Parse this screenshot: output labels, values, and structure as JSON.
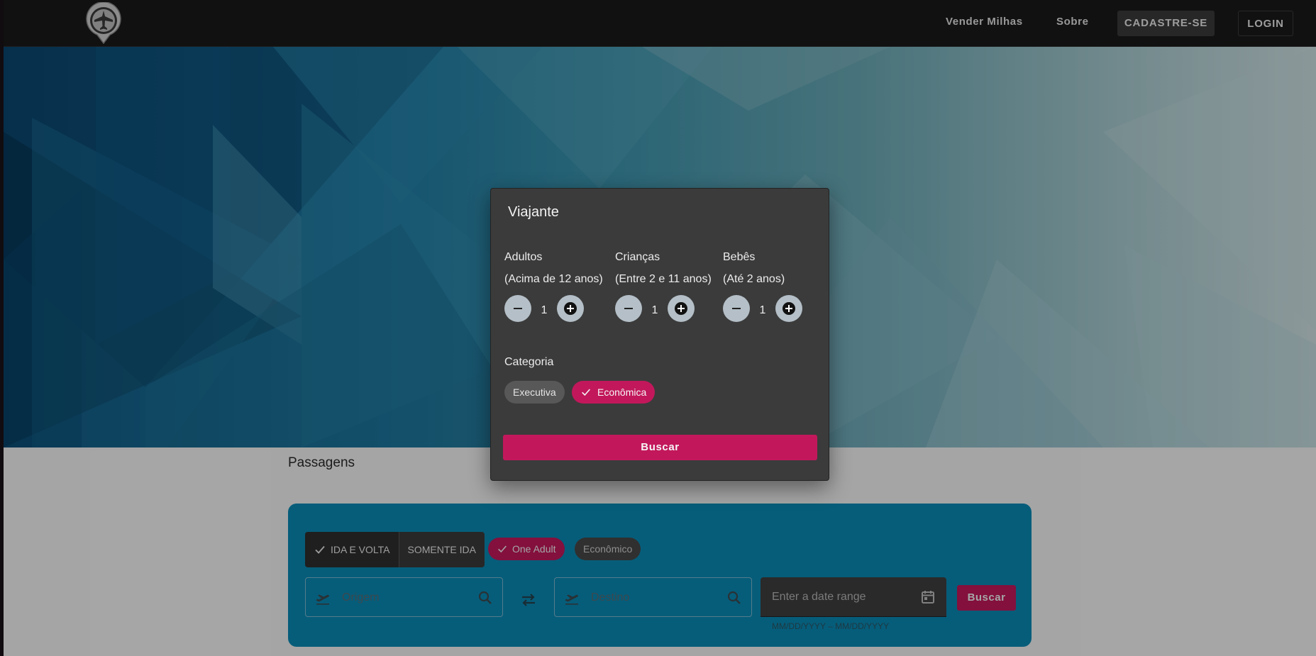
{
  "header": {
    "logo_icon": "airplane-pin-icon",
    "nav": {
      "vender_milhas": "Vender Milhas",
      "sobre": "Sobre",
      "cadastre": "CADASTRE-SE",
      "login": "LOGIN"
    }
  },
  "page": {
    "section_title": "Passagens"
  },
  "search": {
    "trip_types": [
      {
        "label": "IDA E VOLTA",
        "selected": true
      },
      {
        "label": "SOMENTE IDA",
        "selected": false
      }
    ],
    "passenger_chip": "One Adult",
    "class_chip": "Econômico",
    "origin_placeholder": "Origem",
    "destination_placeholder": "Destino",
    "date_placeholder": "Enter a date range",
    "date_hint": "MM/DD/YYYY – MM/DD/YYYY",
    "search_label": "Buscar"
  },
  "dialog": {
    "title": "Viajante",
    "passengers": [
      {
        "label": "Adultos",
        "sub": "(Acima de 12 anos)",
        "count": "1"
      },
      {
        "label": "Crianças",
        "sub": "(Entre 2 e 11 anos)",
        "count": "1"
      },
      {
        "label": "Bebês",
        "sub": "(Até 2 anos)",
        "count": "1"
      }
    ],
    "category_label": "Categoria",
    "categories": [
      {
        "label": "Executiva",
        "selected": false
      },
      {
        "label": "Econômica",
        "selected": true
      }
    ],
    "search_label": "Buscar"
  },
  "colors": {
    "accent": "#c2185b",
    "card": "#0a89b4",
    "dialog": "#3b3b3b",
    "header": "#1a1a1a"
  }
}
